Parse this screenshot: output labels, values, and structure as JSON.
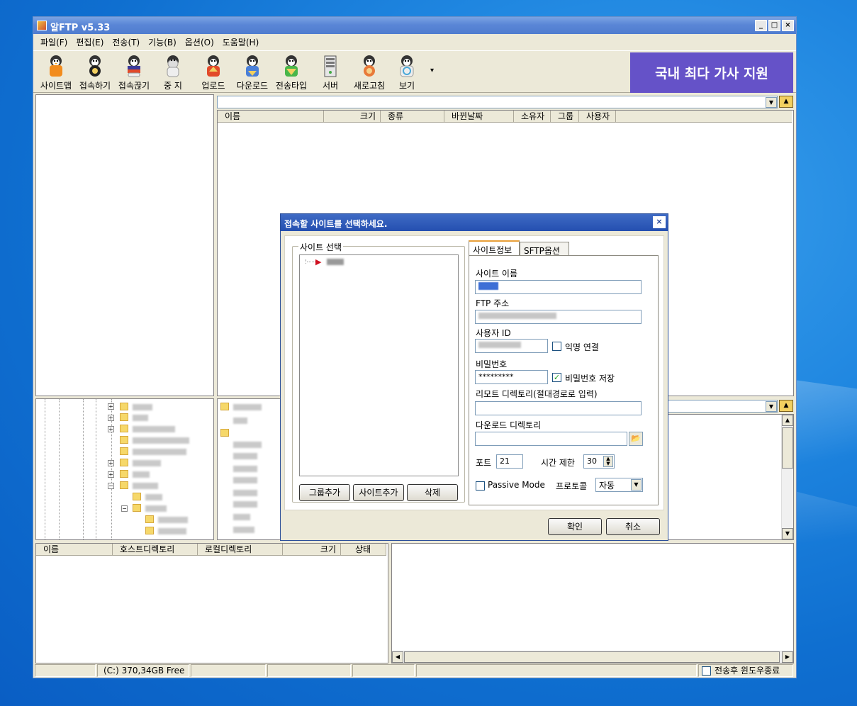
{
  "window": {
    "title": "알FTP  v5.33",
    "buttons": {
      "minimize": "_",
      "maximize": "□",
      "close": "×"
    }
  },
  "menu": [
    "파일(F)",
    "편집(E)",
    "전송(T)",
    "기능(B)",
    "옵션(O)",
    "도움말(H)"
  ],
  "toolbar": {
    "buttons": [
      {
        "label": "사이트맵",
        "icon": "sitemap-penguin-icon",
        "color": "#f28c1e"
      },
      {
        "label": "접속하기",
        "icon": "connect-penguin-icon",
        "color": "#222222"
      },
      {
        "label": "접속끊기",
        "icon": "disconnect-penguin-icon",
        "color": "#3b3b9a"
      },
      {
        "label": "중 지",
        "icon": "stop-penguin-icon",
        "color": "#dddddd"
      },
      {
        "label": "업로드",
        "icon": "upload-penguin-icon",
        "color": "#e24a2a"
      },
      {
        "label": "다운로드",
        "icon": "download-penguin-icon",
        "color": "#4a7fd8"
      },
      {
        "label": "전송타입",
        "icon": "transfer-type-penguin-icon",
        "color": "#48b64a"
      },
      {
        "label": "서버",
        "icon": "server-icon",
        "color": "#cccccc"
      },
      {
        "label": "새로고침",
        "icon": "refresh-penguin-icon",
        "color": "#e87a3a"
      },
      {
        "label": "보기",
        "icon": "view-penguin-icon",
        "color": "#4aa8d8"
      }
    ],
    "more": "▾",
    "banner": "국내 최다 가사 지원"
  },
  "remote_list": {
    "columns": [
      "이름",
      "크기",
      "종류",
      "바뀐날짜",
      "소유자",
      "그룹",
      "사용자"
    ]
  },
  "queue_list": {
    "columns": [
      "이름",
      "호스트디렉토리",
      "로컬디렉토리",
      "크기",
      "상태"
    ]
  },
  "statusbar": {
    "drive": "(C:)  370,34GB Free",
    "close_after_transfer": "전송후 윈도우종료"
  },
  "dialog": {
    "title": "접속할 사이트를 선택하세요.",
    "close": "×",
    "site_group_label": "사이트 선택",
    "buttons": {
      "add_group": "그룹추가",
      "add_site": "사이트추가",
      "delete": "삭제",
      "ok": "확인",
      "cancel": "취소"
    },
    "tabs": [
      "사이트정보",
      "SFTP옵션"
    ],
    "fields": {
      "site_name_label": "사이트 이름",
      "ftp_address_label": "FTP 주소",
      "user_id_label": "사용자 ID",
      "anonymous_label": "익명 연결",
      "password_label": "비밀번호",
      "password_value": "*********",
      "save_password_label": "비밀번호 저장",
      "remote_dir_label": "리모트 디렉토리(절대경로로 입력)",
      "download_dir_label": "다운로드 디렉토리",
      "port_label": "포트",
      "port_value": "21",
      "timeout_label": "시간 제한",
      "timeout_value": "30",
      "passive_label": "Passive Mode",
      "protocol_label": "프로토콜",
      "protocol_value": "자동"
    },
    "state": {
      "anonymous": false,
      "save_password": true,
      "passive": false
    }
  }
}
